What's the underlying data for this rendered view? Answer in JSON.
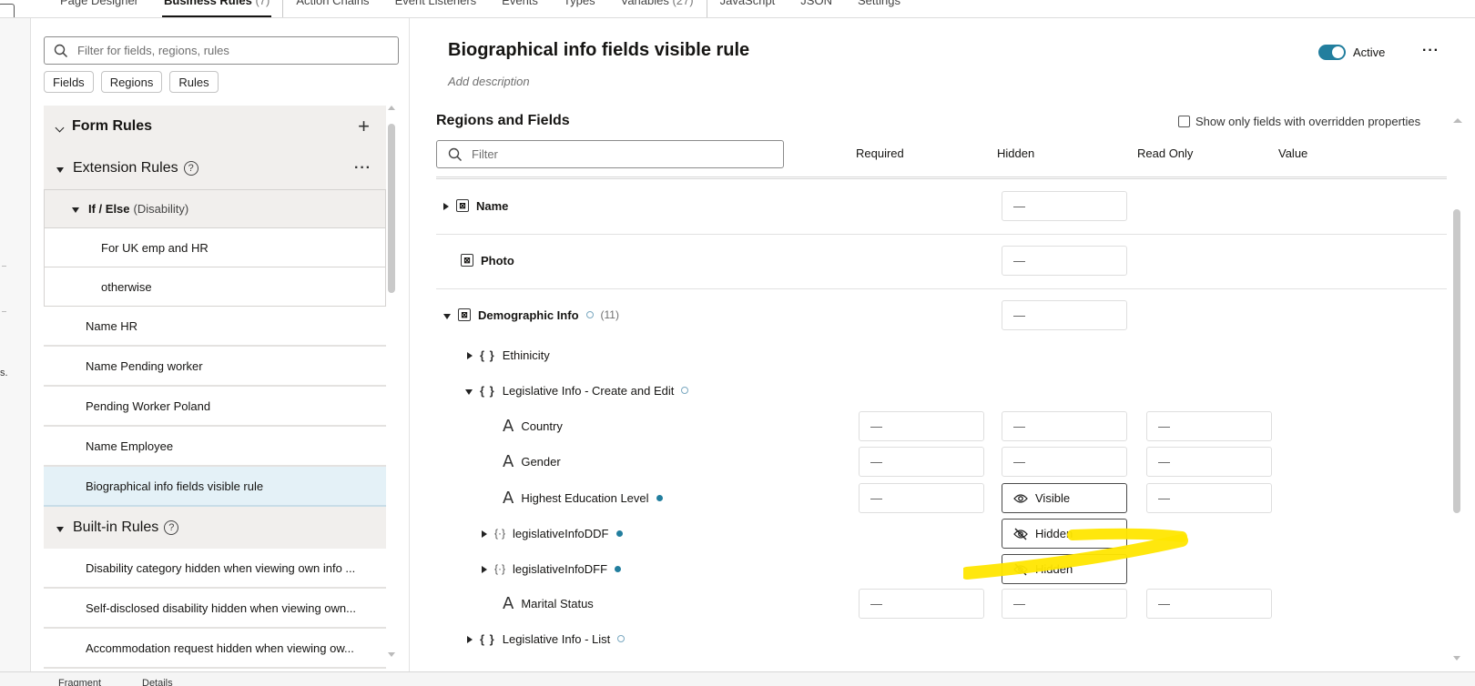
{
  "top_tabs": [
    {
      "label": "Page Designer"
    },
    {
      "label": "Business Rules",
      "count": "(7)"
    },
    {
      "label": "Action Chains"
    },
    {
      "label": "Event Listeners"
    },
    {
      "label": "Events"
    },
    {
      "label": "Types"
    },
    {
      "label": "Variables",
      "count": "(27)"
    },
    {
      "label": "JavaScript"
    },
    {
      "label": "JSON"
    },
    {
      "label": "Settings"
    }
  ],
  "gutter": {
    "mark": "s."
  },
  "rules_panel": {
    "filter_placeholder": "Filter for fields, regions, rules",
    "chips": [
      "Fields",
      "Regions",
      "Rules"
    ],
    "form_rules": "Form Rules",
    "extension_rules": "Extension Rules",
    "if_else": "If / Else",
    "if_else_detail": "(Disability)",
    "branches": [
      "For UK emp and HR",
      "otherwise"
    ],
    "extension_items": [
      "Name HR",
      "Name Pending worker",
      "Pending Worker Poland",
      "Name Employee",
      "Biographical info fields visible rule"
    ],
    "built_in_rules": "Built-in Rules",
    "built_in_items": [
      "Disability category hidden when viewing own info ...",
      "Self-disclosed disability hidden when viewing own...",
      "Accommodation request hidden when viewing ow..."
    ],
    "icons": {
      "help": "?",
      "plus": "+",
      "more": "···"
    }
  },
  "main": {
    "title": "Biographical info fields visible rule",
    "description_placeholder": "Add description",
    "active_label": "Active",
    "more": "···",
    "section_heading": "Regions and Fields",
    "override_label": "Show only fields with overridden properties",
    "filter_placeholder": "Filter",
    "columns": {
      "required": "Required",
      "hidden": "Hidden",
      "read_only": "Read Only",
      "value": "Value"
    },
    "rows": {
      "name": {
        "label": "Name",
        "hidden": "—"
      },
      "photo": {
        "label": "Photo",
        "hidden": "—"
      },
      "demographic": {
        "label": "Demographic Info",
        "count": "(11)",
        "hidden": "—"
      },
      "ethnicity": {
        "label": "Ethinicity"
      },
      "legislative_create": {
        "label": "Legislative Info - Create and Edit"
      },
      "country": {
        "label": "Country",
        "required": "—",
        "hidden": "—",
        "read_only": "—"
      },
      "gender": {
        "label": "Gender",
        "required": "—",
        "hidden": "—",
        "read_only": "—"
      },
      "education": {
        "label": "Highest Education Level",
        "required": "—",
        "hidden": "Visible",
        "read_only": "—"
      },
      "ddf": {
        "label": "legislativeInfoDDF",
        "hidden": "Hidden"
      },
      "dff": {
        "label": "legislativeInfoDFF",
        "hidden": "Hidden"
      },
      "marital": {
        "label": "Marital Status",
        "required": "—",
        "hidden": "—",
        "read_only": "—"
      },
      "legislative_list": {
        "label": "Legislative Info - List"
      }
    },
    "icon_glyphs": {
      "region": "⊠",
      "brace": "{ }",
      "brace_small": "{·}",
      "text": "A"
    }
  },
  "colors": {
    "accent": "#227e9e",
    "selected_row": "#e4f1f7",
    "highlight": "#ffe600"
  },
  "bottom_bar": {
    "item1": "Fragment",
    "item2": "Details"
  }
}
